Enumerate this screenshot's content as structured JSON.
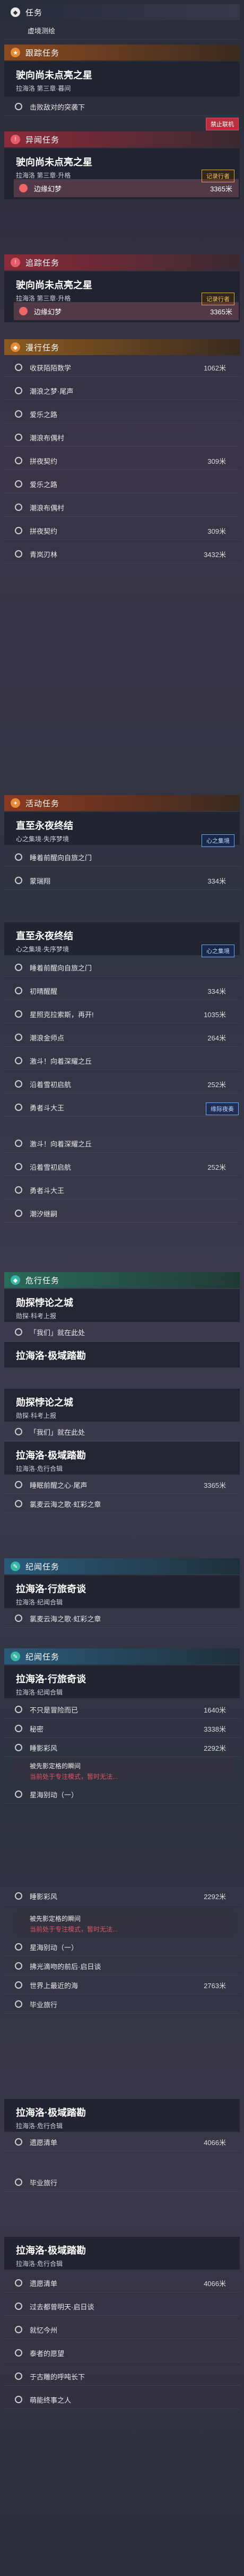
{
  "sections": {
    "task_header": "任务",
    "task_row": "虚境测绘",
    "follow_header": "跟踪任务",
    "follow_title": "驶向尚未点亮之星",
    "follow_sub": "拉海洛 第三章·暮间",
    "follow_row": "击败敌对的突袭下",
    "disable_button": "禁止联机",
    "rare_header": "异闻任务",
    "rare_title": "驶向尚未点亮之星",
    "rare_sub": "拉海洛 第三章·升格",
    "rare_tag": "记录行者",
    "rare_row": "边缘幻梦",
    "rare_dist": "3365米",
    "track2_header": "追踪任务",
    "track2_title": "驶向尚未点亮之星",
    "track2_sub": "拉海洛 第三章·升格",
    "track2_tag": "记录行者",
    "track2_row": "边缘幻梦",
    "track2_dist": "3365米",
    "daily_header": "漫行任务",
    "daily_rows": [
      {
        "label": "收获陌陌数学",
        "dist": "1062米"
      },
      {
        "label": "潮浪之梦·尾声",
        "dist": ""
      },
      {
        "label": "爱乐之路",
        "dist": ""
      },
      {
        "label": "潮浪布偶村",
        "dist": ""
      },
      {
        "label": "拼夜契约",
        "dist": "309米"
      },
      {
        "label": "爱乐之路",
        "dist": ""
      },
      {
        "label": "潮浪布偶村",
        "dist": ""
      },
      {
        "label": "拼夜契约",
        "dist": "309米"
      },
      {
        "label": "青岚刃林",
        "dist": "3432米"
      }
    ],
    "event_header": "活动任务",
    "event_title": "直至永夜终结",
    "event_sub": "心之集境·失序梦境",
    "event_tag": "心之集境",
    "event_rows": [
      {
        "label": "睡着前醒向自旅之门",
        "dist": ""
      },
      {
        "label": "蒙瑞翔",
        "dist": "334米"
      }
    ],
    "event2_title": "直至永夜终结",
    "event2_sub": "心之集境·失序梦境",
    "event2_tag": "心之集境",
    "event2_rows": [
      {
        "label": "睡着前醒向自旅之门",
        "dist": ""
      },
      {
        "label": "初晴醒醒",
        "dist": "334米"
      },
      {
        "label": "星照克拉索斯，再开!",
        "dist": "1035米"
      },
      {
        "label": "潮浪金师点",
        "dist": "264米"
      },
      {
        "label": "激斗！向着深耀之丘",
        "dist": ""
      },
      {
        "label": "沿着雪初启航",
        "dist": "252米"
      },
      {
        "label": "勇者斗大王",
        "dist": ""
      }
    ],
    "event2_tag2": "缘际夜奏",
    "event3_rows": [
      {
        "label": "激斗！向着深耀之丘",
        "dist": ""
      },
      {
        "label": "沿着雪初启航",
        "dist": "252米"
      },
      {
        "label": "勇者斗大王",
        "dist": ""
      },
      {
        "label": "潮汐继嗣",
        "dist": ""
      }
    ],
    "danger_header": "危行任务",
    "danger_title": "勋探悖论之城",
    "danger_sub": "勋探·科考上报",
    "danger_row": "「我们」就在此处",
    "bond_title": "拉海洛·极域踏勘",
    "danger2_title": "勋探悖论之城",
    "danger2_sub": "勋探·科考上报",
    "danger2_row": "「我们」就在此处",
    "bond2_title": "拉海洛·极域踏勘",
    "bond2_sub": "拉海洛·危行合辑",
    "bond2_row": "睡眠前醒之心·尾声",
    "bond2_dist": "3365米",
    "bond2_row2": "氯麦云海之歌·虹彩之章",
    "group_header": "纪闻任务",
    "group_title": "拉海洛·行旅奇谈",
    "group_sub": "拉海洛·纪闻合辑",
    "group_row": "氯麦云海之歌·虹彩之章",
    "group2_header": "纪闻任务",
    "group2_title": "拉海洛·行旅奇谈",
    "group2_sub": "拉海洛·纪闻合辑",
    "group2_rows": [
      {
        "label": "不只是冒险而已",
        "dist": "1640米"
      },
      {
        "label": "秘密",
        "dist": "3338米"
      },
      {
        "label": "睡影彩风",
        "dist": "2292米"
      }
    ],
    "warn1_a": "被先影定格的瞬间",
    "warn1_b": "当前处于专注模式，暂时无法...",
    "group2_rows_b": [
      {
        "label": "星海别动（一）",
        "dist": ""
      }
    ],
    "group3_rows": [
      {
        "label": "睡影彩风",
        "dist": "2292米"
      }
    ],
    "warn2_a": "被先影定格的瞬间",
    "warn2_b": "当前处于专注模式，暂时无法...",
    "group3_rows_b": [
      {
        "label": "星海别动（一）",
        "dist": ""
      },
      {
        "label": "拂光滴吻的前后·启日谈",
        "dist": ""
      },
      {
        "label": "世界上最近的海",
        "dist": "2763米"
      },
      {
        "label": "毕业旅行",
        "dist": ""
      }
    ],
    "bond3_title": "拉海洛·极域踏勘",
    "bond3_sub": "拉海洛·危行合辑",
    "bond3_row": "遗愿清单",
    "bond3_dist": "4066米",
    "bond3_row2": "毕业旅行",
    "bond4_title": "拉海洛·极域踏勘",
    "bond4_sub": "拉海洛·危行合辑",
    "bond4_rows": [
      {
        "label": "遗愿清单",
        "dist": "4066米"
      },
      {
        "label": "过去都曾明天·启日谈",
        "dist": ""
      },
      {
        "label": "就忆今州",
        "dist": ""
      },
      {
        "label": "泰者的愿望",
        "dist": ""
      },
      {
        "label": "于古雕的呼吨长下",
        "dist": ""
      },
      {
        "label": "萌能终事之人",
        "dist": ""
      }
    ]
  },
  "colors": {
    "accent_red": "#e35d6a",
    "accent_green": "#2dbf6b",
    "accent_orange": "#e58b3a",
    "accent_teal": "#39b7a7",
    "gold": "#f2c15a"
  }
}
